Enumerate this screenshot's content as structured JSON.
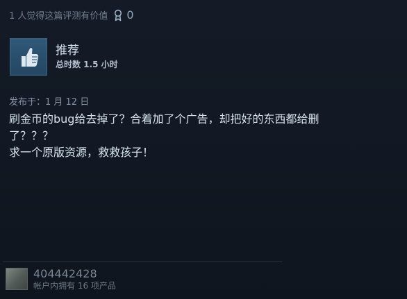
{
  "header": {
    "helpful_text": "1 人觉得这篇评测有价值",
    "award_count": "0",
    "award_icon": "award-icon"
  },
  "recommendation": {
    "icon": "thumbs-up-icon",
    "title": "推荐",
    "hours": "总时数 1.5 小时"
  },
  "review": {
    "posted": "发布于：1 月 12 日",
    "lines": [
      "刷金币的bug给去掉了？合着加了个广告，却把好的东西都给删",
      "了？？？",
      "求一个原版资源，救救孩子！"
    ]
  },
  "author": {
    "name": "404442428",
    "products": "帐户内拥有 16 项产品",
    "avatar": "avatar-image"
  }
}
